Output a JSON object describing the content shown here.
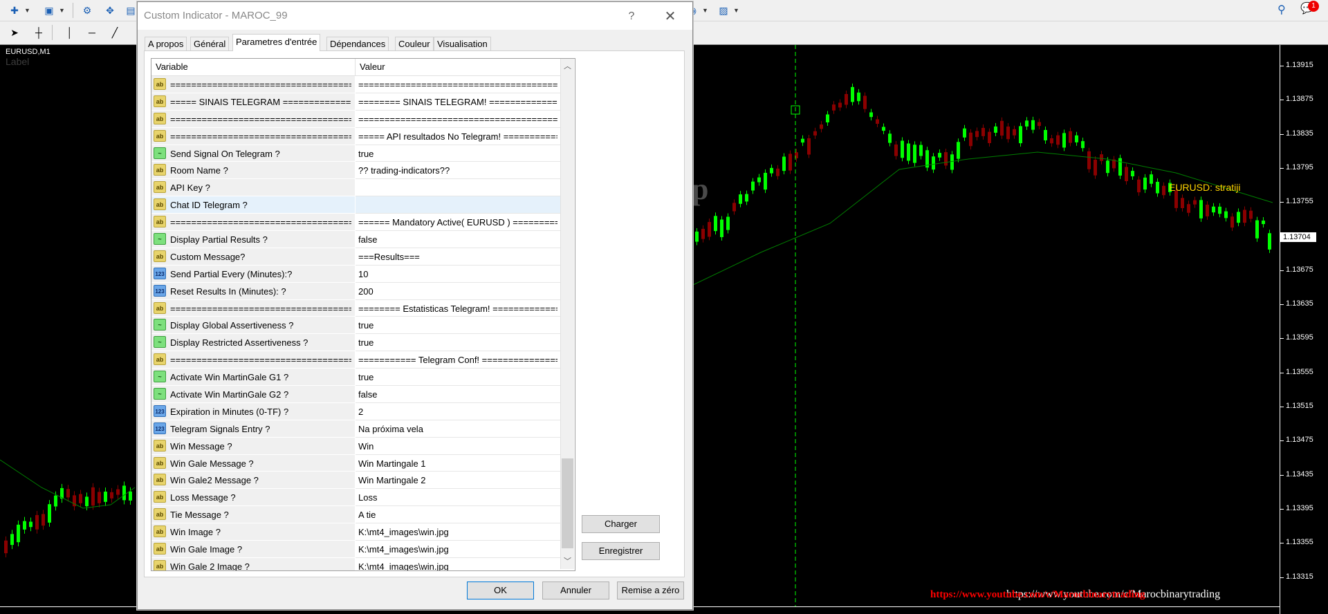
{
  "chart": {
    "title": "EURUSD,M1",
    "label": "Label",
    "indicator_label": "EURUSD: stratiji",
    "big_letter": "p",
    "url_text": "https://www.youtube.com/c/Marocbinarytrading",
    "watermark": "https://www.youtube.com/c/Marocbinarytrading",
    "current_price": "1.13704",
    "price_ticks": [
      "1.13915",
      "1.13875",
      "1.13835",
      "1.13795",
      "1.13755",
      "1.13715",
      "1.13675",
      "1.13635",
      "1.13595",
      "1.13555",
      "1.13515",
      "1.13475",
      "1.13435",
      "1.13395",
      "1.13355",
      "1.13315"
    ],
    "notification_count": "1",
    "colors": {
      "bull": "#00ff00",
      "bear": "#8b0000",
      "ma": "#008000",
      "label": "#ffd400"
    }
  },
  "dialog": {
    "title": "Custom Indicator - MAROC_99",
    "help": "?",
    "close": "✕",
    "tabs": [
      "A propos",
      "Général",
      "Parametres d'entrée",
      "Dépendances",
      "Couleur",
      "Visualisation"
    ],
    "active_tab": "Parametres d'entrée",
    "grid": {
      "col_variable": "Variable",
      "col_value": "Valeur",
      "rows": [
        {
          "type": "ab",
          "var": "=====================================================",
          "val": "=====================================================",
          "sel": false
        },
        {
          "type": "ab",
          "var": "===== SINAIS TELEGRAM =====================",
          "val": "======== SINAIS TELEGRAM! =====================",
          "sel": false
        },
        {
          "type": "ab",
          "var": "=====================================================",
          "val": "=====================================================",
          "sel": false
        },
        {
          "type": "ab",
          "var": "=====================================================",
          "val": "===== API resultados No Telegram! ===============",
          "sel": false
        },
        {
          "type": "bool",
          "var": "Send Signal On Telegram ?",
          "val": "true",
          "sel": false
        },
        {
          "type": "ab",
          "var": "Room Name ?",
          "val": "?? trading-indicators??",
          "sel": false
        },
        {
          "type": "ab",
          "var": "API Key ?",
          "val": "",
          "sel": false
        },
        {
          "type": "ab",
          "var": "Chat ID Telegram ?",
          "val": "",
          "sel": true
        },
        {
          "type": "ab",
          "var": "=====================================================",
          "val": "====== Mandatory Active( EURUSD ) ===============",
          "sel": false
        },
        {
          "type": "bool",
          "var": "Display Partial Results ?",
          "val": "false",
          "sel": false
        },
        {
          "type": "ab",
          "var": "Custom Message?",
          "val": "===Results===",
          "sel": false
        },
        {
          "type": "num",
          "var": "Send Partial Every (Minutes):?",
          "val": "10",
          "sel": false
        },
        {
          "type": "num",
          "var": "Reset Results In (Minutes): ?",
          "val": "200",
          "sel": false
        },
        {
          "type": "ab",
          "var": "=====================================================",
          "val": "======== Estatisticas Telegram! =================",
          "sel": false
        },
        {
          "type": "bool",
          "var": "Display Global Assertiveness ?",
          "val": "true",
          "sel": false
        },
        {
          "type": "bool",
          "var": "Display Restricted Assertiveness ?",
          "val": "true",
          "sel": false
        },
        {
          "type": "ab",
          "var": "=====================================================",
          "val": "=========== Telegram Conf! ======================",
          "sel": false
        },
        {
          "type": "bool",
          "var": "Activate Win MartinGale G1 ?",
          "val": "true",
          "sel": false
        },
        {
          "type": "bool",
          "var": "Activate Win MartinGale G2 ?",
          "val": "false",
          "sel": false
        },
        {
          "type": "num",
          "var": "Expiration in Minutes (0-TF) ?",
          "val": "2",
          "sel": false
        },
        {
          "type": "num",
          "var": "Telegram Signals Entry ?",
          "val": "Na próxima vela",
          "sel": false
        },
        {
          "type": "ab",
          "var": "Win Message ?",
          "val": " Win",
          "sel": false
        },
        {
          "type": "ab",
          "var": "Win Gale Message ?",
          "val": "Win  Martingale 1",
          "sel": false
        },
        {
          "type": "ab",
          "var": "Win Gale2 Message ?",
          "val": "Win  Martingale 2",
          "sel": false
        },
        {
          "type": "ab",
          "var": "Loss Message ?",
          "val": "Loss",
          "sel": false
        },
        {
          "type": "ab",
          "var": "Tie Message ?",
          "val": "A tie",
          "sel": false
        },
        {
          "type": "ab",
          "var": "Win Image ?",
          "val": "K:\\mt4_images\\win.jpg",
          "sel": false
        },
        {
          "type": "ab",
          "var": "Win Gale Image ?",
          "val": "K:\\mt4_images\\win.jpg",
          "sel": false
        },
        {
          "type": "ab",
          "var": "Win Gale 2 Image ?",
          "val": "K:\\mt4_images\\win.jpg",
          "sel": false
        }
      ]
    },
    "buttons": {
      "load": "Charger",
      "save": "Enregistrer",
      "ok": "OK",
      "cancel": "Annuler",
      "reset": "Remise a zéro"
    }
  },
  "icons": {
    "ab": "ab",
    "bool": "~",
    "num": "123"
  }
}
